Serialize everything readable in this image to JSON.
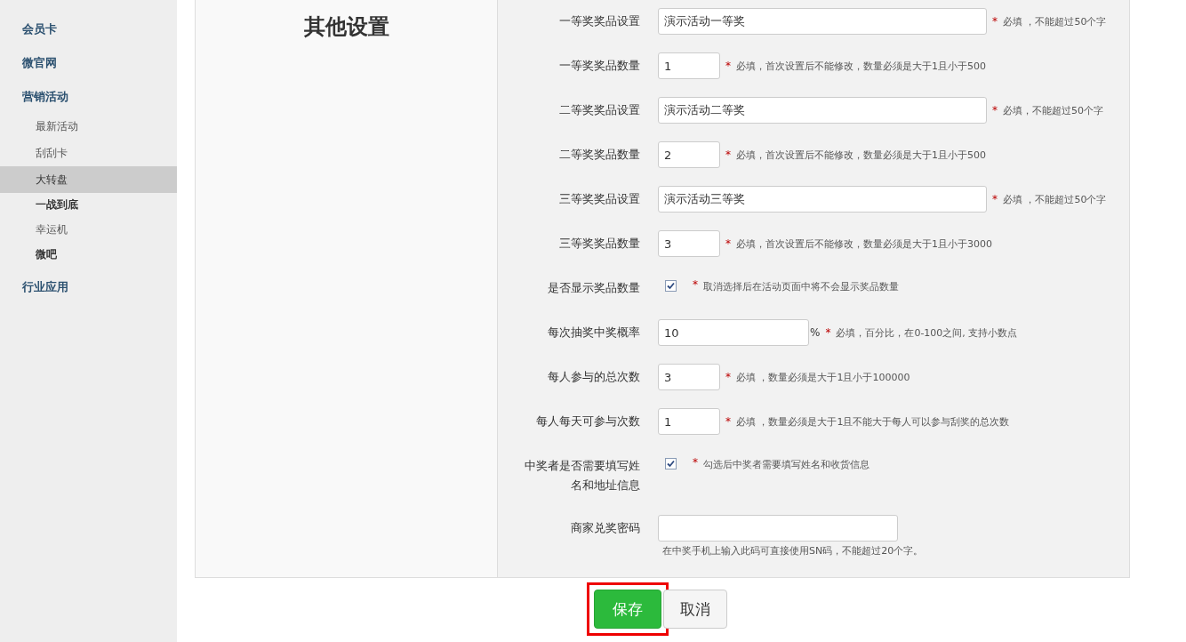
{
  "sidebar": {
    "items": [
      {
        "label": "会员卡"
      },
      {
        "label": "微官网"
      },
      {
        "label": "营销活动",
        "children": [
          {
            "label": "最新活动",
            "selected": false,
            "emphasized": false
          },
          {
            "label": "刮刮卡",
            "selected": false,
            "emphasized": false
          },
          {
            "label": "大转盘",
            "selected": true,
            "emphasized": false
          },
          {
            "label": "一战到底",
            "selected": false,
            "emphasized": true
          },
          {
            "label": "幸运机",
            "selected": false,
            "emphasized": false
          },
          {
            "label": "微吧",
            "selected": false,
            "emphasized": true
          }
        ]
      },
      {
        "label": "行业应用"
      }
    ]
  },
  "section": {
    "title": "其他设置"
  },
  "fields": [
    {
      "kind": "wide",
      "label": "一等奖奖品设置",
      "value": "演示活动一等奖",
      "mark": "*",
      "hint": "必填 ，不能超过50个字"
    },
    {
      "kind": "short",
      "label": "一等奖奖品数量",
      "value": "1",
      "mark": "*",
      "hint": "必填，首次设置后不能修改，数量必须是大于1且小于500"
    },
    {
      "kind": "wide",
      "label": "二等奖奖品设置",
      "value": "演示活动二等奖",
      "mark": "*",
      "hint": "必填，不能超过50个字"
    },
    {
      "kind": "short",
      "label": "二等奖奖品数量",
      "value": "2",
      "mark": "*",
      "hint": "必填，首次设置后不能修改，数量必须是大于1且小于500"
    },
    {
      "kind": "wide",
      "label": "三等奖奖品设置",
      "value": "演示活动三等奖",
      "mark": "*",
      "hint": "必填 ，不能超过50个字"
    },
    {
      "kind": "short",
      "label": "三等奖奖品数量",
      "value": "3",
      "mark": "*",
      "hint": "必填，首次设置后不能修改，数量必须是大于1且小于3000"
    },
    {
      "kind": "checkbox",
      "label": "是否显示奖品数量",
      "checked": true,
      "mark": "*",
      "hint": "取消选择后在活动页面中将不会显示奖品数量"
    },
    {
      "kind": "medium",
      "label": "每次抽奖中奖概率",
      "value": "10",
      "unit": "%",
      "mark": "*",
      "hint": "必填，百分比，在0-100之间, 支持小数点"
    },
    {
      "kind": "short",
      "label": "每人参与的总次数",
      "value": "3",
      "mark": "*",
      "hint": "必填 ，数量必须是大于1且小于100000"
    },
    {
      "kind": "short",
      "label": "每人每天可参与次数",
      "value": "1",
      "mark": "*",
      "hint": "必填 ，数量必须是大于1且不能大于每人可以参与刮奖的总次数"
    },
    {
      "kind": "checkbox",
      "label": "中奖者是否需要填写姓名和地址信息",
      "checked": true,
      "mark": "*",
      "hint": "勾选后中奖者需要填写姓名和收货信息"
    },
    {
      "kind": "long",
      "label": "商家兑奖密码",
      "note": "在中奖手机上输入此码可直接使用SN码，不能超过20个字。"
    }
  ],
  "buttons": [
    {
      "kind": "primary",
      "label": "保存",
      "highlighted": true
    },
    {
      "kind": "default",
      "label": "取消",
      "highlighted": false
    }
  ]
}
